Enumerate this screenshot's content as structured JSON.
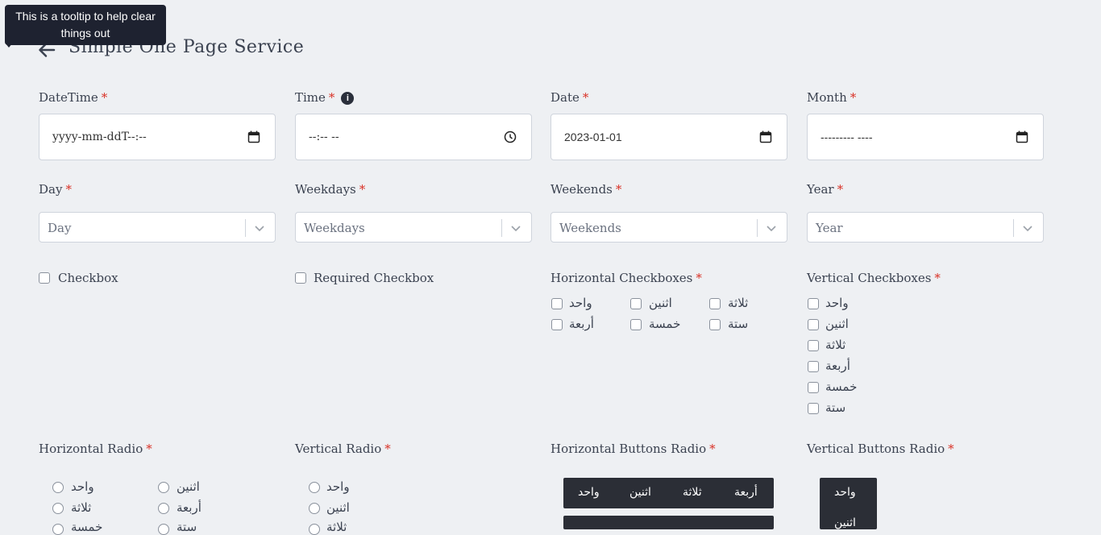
{
  "tooltip": {
    "text": "This is a tooltip to help clear things out"
  },
  "header": {
    "title": "Simple One Page Service"
  },
  "fields": {
    "datetime": {
      "label": "DateTime",
      "required": "*",
      "value": "yyyy-mm-ddT--:--"
    },
    "time": {
      "label": "Time",
      "required": "*",
      "value": "--:-- --",
      "info": "i"
    },
    "date": {
      "label": "Date",
      "required": "*",
      "value": "2023-01-01"
    },
    "month": {
      "label": "Month",
      "required": "*",
      "value": "--------- ----"
    },
    "day": {
      "label": "Day",
      "required": "*",
      "placeholder": "Day"
    },
    "weekdays": {
      "label": "Weekdays",
      "required": "*",
      "placeholder": "Weekdays"
    },
    "weekends": {
      "label": "Weekends",
      "required": "*",
      "placeholder": "Weekends"
    },
    "year": {
      "label": "Year",
      "required": "*",
      "placeholder": "Year"
    },
    "checkbox": {
      "label": "Checkbox"
    },
    "required_checkbox": {
      "label": "Required Checkbox"
    },
    "horizontal_checkboxes": {
      "label": "Horizontal Checkboxes",
      "required": "*",
      "options": [
        "واحد",
        "اثنين",
        "ثلاثة",
        "أربعة",
        "خمسة",
        "ستة"
      ]
    },
    "vertical_checkboxes": {
      "label": "Vertical Checkboxes",
      "required": "*",
      "options": [
        "واحد",
        "اثنين",
        "ثلاثة",
        "أربعة",
        "خمسة",
        "ستة"
      ]
    },
    "horizontal_radio": {
      "label": "Horizontal Radio",
      "required": "*",
      "options": [
        "واحد",
        "اثنين",
        "ثلاثة",
        "أربعة",
        "خمسة",
        "ستة"
      ]
    },
    "vertical_radio": {
      "label": "Vertical Radio",
      "required": "*",
      "options": [
        "واحد",
        "اثنين",
        "ثلاثة"
      ]
    },
    "horizontal_buttons_radio": {
      "label": "Horizontal Buttons Radio",
      "required": "*",
      "options": [
        "واحد",
        "اثنين",
        "ثلاثة",
        "أربعة"
      ]
    },
    "vertical_buttons_radio": {
      "label": "Vertical Buttons Radio",
      "required": "*",
      "options": [
        "واحد",
        "اثنين"
      ]
    }
  },
  "colors": {
    "background": "#eef0f3",
    "required": "#d93025",
    "button_dark": "#2b2e36",
    "tooltip": "#1e2230"
  }
}
